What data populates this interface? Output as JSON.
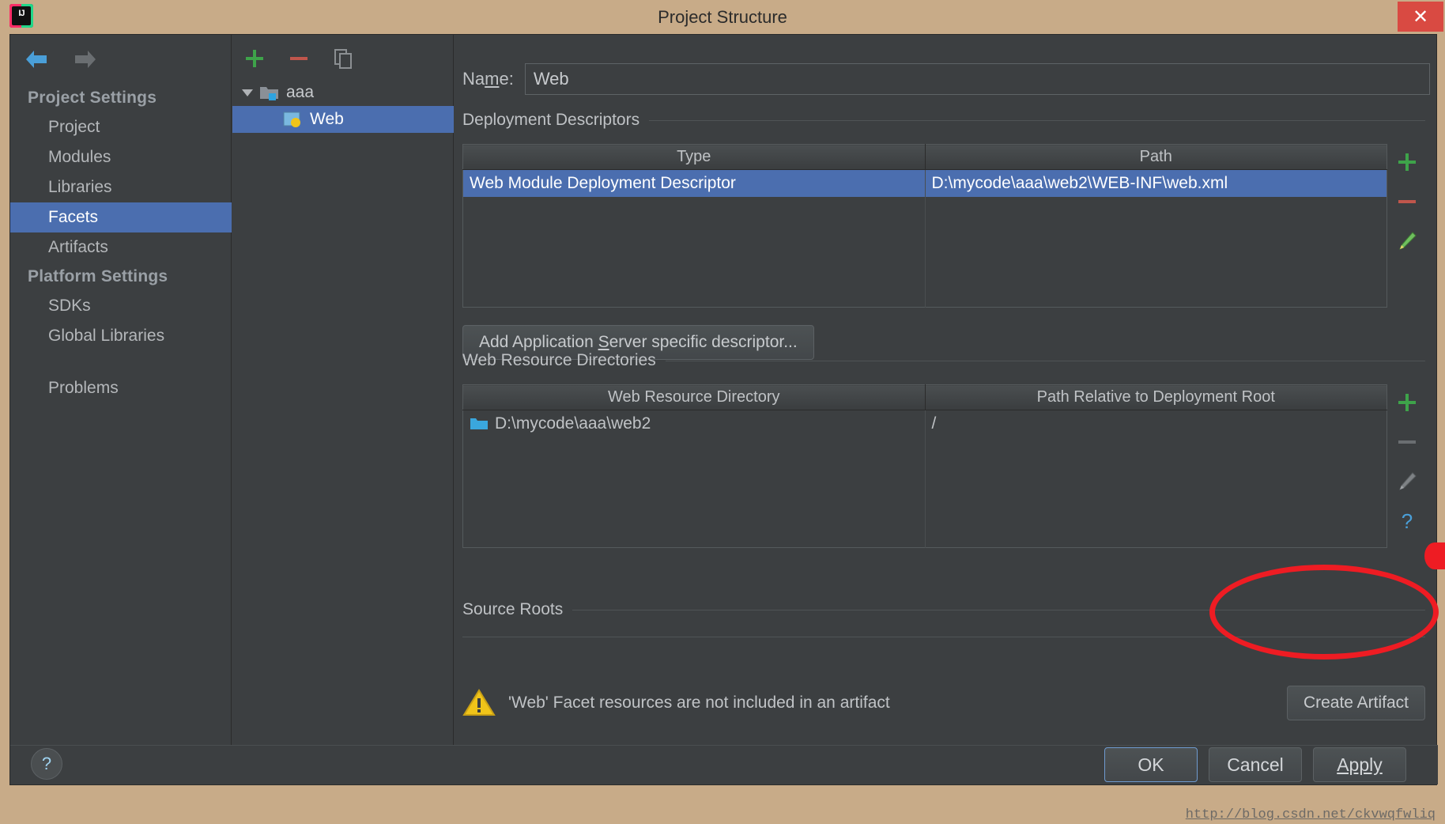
{
  "window": {
    "title": "Project Structure",
    "app_icon": "intellij-idea-icon",
    "close_label": "✕"
  },
  "sidebar": {
    "back_icon": "arrow-left-icon",
    "forward_icon": "arrow-right-icon",
    "groups": [
      {
        "label": "Project Settings",
        "items": [
          {
            "label": "Project",
            "selected": false
          },
          {
            "label": "Modules",
            "selected": false
          },
          {
            "label": "Libraries",
            "selected": false
          },
          {
            "label": "Facets",
            "selected": true
          },
          {
            "label": "Artifacts",
            "selected": false
          }
        ]
      },
      {
        "label": "Platform Settings",
        "items": [
          {
            "label": "SDKs",
            "selected": false
          },
          {
            "label": "Global Libraries",
            "selected": false
          }
        ]
      }
    ],
    "problems": {
      "label": "Problems"
    }
  },
  "tree": {
    "toolbar": [
      {
        "name": "add-facet-button",
        "icon": "plus-icon",
        "label": "+"
      },
      {
        "name": "remove-facet-button",
        "icon": "minus-icon",
        "label": "−"
      },
      {
        "name": "copy-facet-button",
        "icon": "copy-icon",
        "label": "⧉"
      }
    ],
    "nodes": [
      {
        "label": "aaa",
        "icon": "module-folder-icon",
        "expanded": true,
        "depth": 0,
        "selected": false
      },
      {
        "label": "Web",
        "icon": "web-facet-icon",
        "expanded": false,
        "depth": 1,
        "selected": true
      }
    ]
  },
  "content": {
    "name_label_pre": "Na",
    "name_label_mnemonic": "m",
    "name_label_post": "e:",
    "name_value": "Web",
    "deployment": {
      "section_label": "Deployment Descriptors",
      "columns": [
        "Type",
        "Path"
      ],
      "rows": [
        {
          "type": "Web Module Deployment Descriptor",
          "path": "D:\\mycode\\aaa\\web2\\WEB-INF\\web.xml",
          "selected": true
        }
      ],
      "actions": [
        {
          "name": "add-descriptor-button",
          "icon": "plus-icon",
          "enabled": true
        },
        {
          "name": "remove-descriptor-button",
          "icon": "minus-icon",
          "enabled": true
        },
        {
          "name": "edit-descriptor-button",
          "icon": "pencil-icon",
          "enabled": true
        }
      ],
      "add_button_pre": "Add Application ",
      "add_button_mnemonic": "S",
      "add_button_post": "erver specific descriptor..."
    },
    "resources": {
      "section_label": "Web Resource Directories",
      "columns": [
        "Web Resource Directory",
        "Path Relative to Deployment Root"
      ],
      "rows": [
        {
          "dir": "D:\\mycode\\aaa\\web2",
          "dir_icon": "folder-icon",
          "rel": "/",
          "selected": false
        }
      ],
      "actions": [
        {
          "name": "add-resource-button",
          "icon": "plus-icon",
          "enabled": true
        },
        {
          "name": "remove-resource-button",
          "icon": "minus-icon",
          "enabled": false
        },
        {
          "name": "edit-resource-button",
          "icon": "pencil-icon",
          "enabled": false
        },
        {
          "name": "resource-help-button",
          "icon": "question-icon",
          "enabled": true
        }
      ]
    },
    "source_roots": {
      "section_label": "Source Roots"
    },
    "warning": {
      "icon": "warning-triangle-icon",
      "text": "'Web' Facet resources are not included in an artifact",
      "action_label": "Create Artifact"
    }
  },
  "footer": {
    "help_label": "?",
    "buttons": [
      {
        "label": "OK",
        "name": "ok-button",
        "default": true
      },
      {
        "label": "Cancel",
        "name": "cancel-button",
        "default": false
      },
      {
        "label": "Apply",
        "name": "apply-button",
        "default": false,
        "mnemonic": "A"
      }
    ]
  },
  "watermark": {
    "text": "http://blog.csdn.net/ckvwqfwliq"
  },
  "colors": {
    "titlebar": "#c8ab88",
    "close": "#d94a42",
    "panel": "#3c3f41",
    "selection": "#4b6eaf",
    "accent_green": "#3ea34a",
    "accent_red": "#c05a50",
    "annotation": "#ee1c23"
  }
}
